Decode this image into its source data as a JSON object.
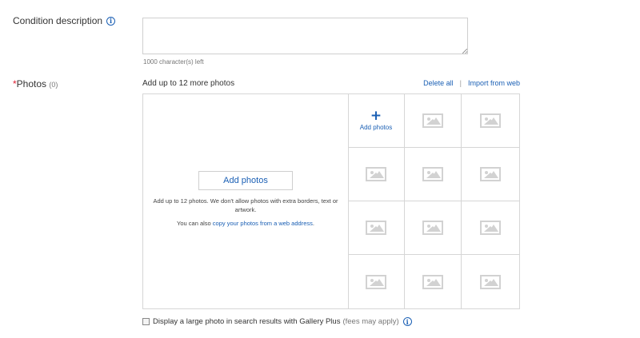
{
  "condition": {
    "label": "Condition description",
    "info_icon": "info-icon",
    "value": "",
    "chars_left": "1000 character(s) left"
  },
  "photos": {
    "required_mark": "*",
    "label": "Photos",
    "count": "(0)",
    "add_up_text": "Add up to 12 more photos",
    "delete_all": "Delete all",
    "separator": "|",
    "import_from_web": "Import from web",
    "add_button": "Add photos",
    "help_text": "Add up to 12 photos. We don't allow photos with extra borders, text or artwork.",
    "copy_prefix": "You can also ",
    "copy_link": "copy your photos from a web address",
    "copy_suffix": ".",
    "grid_add_symbol": "+",
    "grid_add_label": "Add photos",
    "placeholder_icon": "image-placeholder-icon"
  },
  "gallery": {
    "label": "Display a large photo in search results with Gallery Plus",
    "fees": "(fees may apply)",
    "checked": false
  },
  "colors": {
    "link": "#1a5fb4",
    "required": "#dd1e31",
    "border": "#d6d6d6"
  }
}
